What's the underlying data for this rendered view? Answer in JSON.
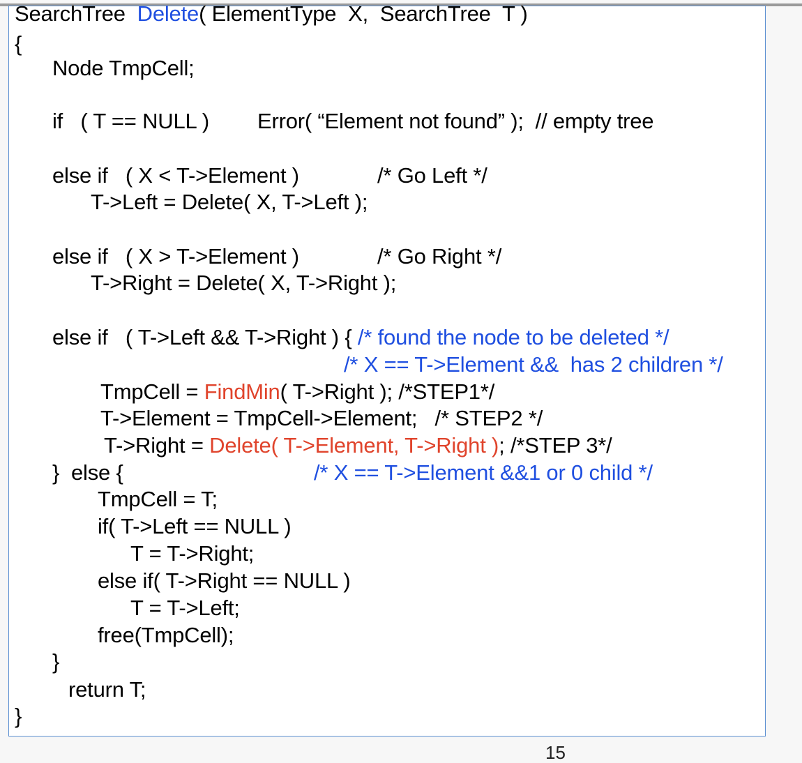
{
  "colors": {
    "frame_border": "#5b8fd1",
    "highlight_blue": "#1f4fe0",
    "highlight_red": "#e0442c",
    "text": "#000000"
  },
  "code": {
    "signature": {
      "pre": "SearchTree  ",
      "func": "Delete",
      "post": "( ElementType  X,  SearchTree  T )"
    },
    "open_brace": "{",
    "decl": "Node TmpCell;",
    "if_null": {
      "cond": "if   ( T == NULL )",
      "action": "Error( “Element not found” );  // empty tree"
    },
    "elif_left": {
      "cond": "else if   ( X < T->Element )",
      "comment": "/* Go Left */"
    },
    "left_assign": "T->Left = Delete( X, T->Left );",
    "elif_right": {
      "cond": "else if   ( X > T->Element )",
      "comment": "/* Go Right */"
    },
    "right_assign": "T->Right = Delete( X, T->Right );",
    "elif_both": {
      "cond": "else if   ( T->Left && T->Right ) { ",
      "comment": "/* found the node to be deleted */"
    },
    "two_children_comment": "/* X == T->Element &&  has 2 children */",
    "step1": {
      "pre": "TmpCell = ",
      "func": "FindMin",
      "post": "( T->Right ); /*STEP1*/"
    },
    "step2": "T->Element = TmpCell->Element;   /* STEP2 */",
    "step3": {
      "pre": "T->Right = ",
      "call": "Delete( T->Element, T->Right )",
      "post": "; /*STEP 3*/"
    },
    "else_open": "}  else {",
    "else_comment": "/* X == T->Element &&1 or 0 child */",
    "tmp_assign": "TmpCell = T;",
    "if_left_null": "if( T->Left == NULL )",
    "t_right": "T = T->Right;",
    "elif_right_null": "else if( T->Right == NULL )",
    "t_left": "T = T->Left;",
    "free": "free(TmpCell);",
    "close_inner": "}",
    "return": "return T;",
    "close_brace": "}"
  },
  "footer": {
    "page_number": "15"
  }
}
